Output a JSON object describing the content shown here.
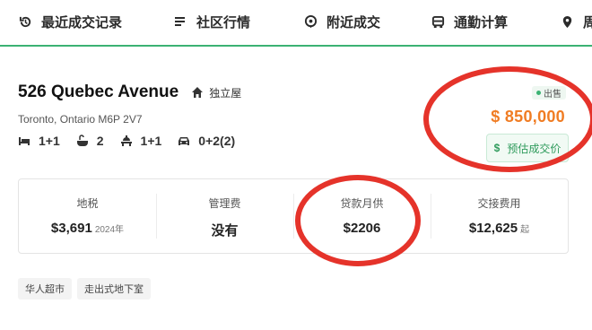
{
  "nav": {
    "items": [
      {
        "label": "最近成交记录",
        "icon": "history-icon"
      },
      {
        "label": "社区行情",
        "icon": "list-icon"
      },
      {
        "label": "附近成交",
        "icon": "location-pin-icon"
      },
      {
        "label": "通勤计算",
        "icon": "bus-icon"
      },
      {
        "label": "周",
        "icon": "map-pin-icon"
      }
    ]
  },
  "listing": {
    "title": "526 Quebec Avenue",
    "property_type": "独立屋",
    "address": "Toronto, Ontario M6P 2V7",
    "features": [
      {
        "icon": "bed-icon",
        "value": "1+1"
      },
      {
        "icon": "bath-icon",
        "value": "2"
      },
      {
        "icon": "kitchen-icon",
        "value": "1+1"
      },
      {
        "icon": "car-icon",
        "value": "0+2(2)"
      }
    ],
    "status_badge": "出售",
    "price": "$ 850,000",
    "estimate_button_icon": "$",
    "estimate_button": "预估成交价"
  },
  "stats": [
    {
      "label": "地税",
      "value": "$3,691",
      "suffix": "2024年"
    },
    {
      "label": "管理费",
      "value": "没有",
      "suffix": ""
    },
    {
      "label": "贷款月供",
      "value": "$2206",
      "suffix": ""
    },
    {
      "label": "交接费用",
      "value": "$12,625",
      "suffix": "起"
    }
  ],
  "tags": [
    "华人超市",
    "走出式地下室"
  ],
  "colors": {
    "accent_green": "#3bb273",
    "price_orange": "#f07c23",
    "annotation_red": "#e5332a"
  }
}
